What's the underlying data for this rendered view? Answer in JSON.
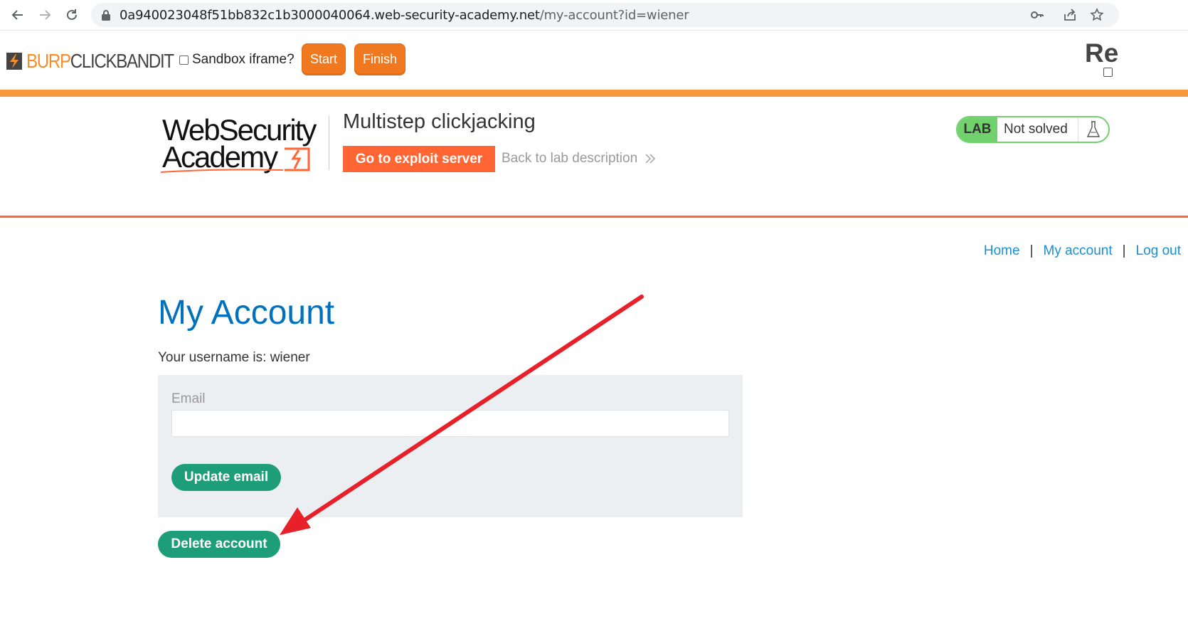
{
  "browser": {
    "url_host": "0a940023048f51bb832c1b3000040064.web-security-academy.net",
    "url_path": "/my-account?id=wiener"
  },
  "clickbandit": {
    "logo_burp": "BURP",
    "logo_clickbandit": "CLICKBANDIT",
    "sandbox_label": "Sandbox iframe?",
    "start_label": "Start",
    "finish_label": "Finish",
    "record_label_partial": "Re",
    "accent_color": "#f0791f"
  },
  "lab_header": {
    "logo_line1": "WebSecurity",
    "logo_line2": "Academy",
    "title": "Multistep clickjacking",
    "exploit_button": "Go to exploit server",
    "back_link": "Back to lab description",
    "status_tag": "LAB",
    "status_text": "Not solved",
    "status_color": "#70d16d"
  },
  "top_nav": {
    "home": "Home",
    "my_account": "My account",
    "log_out": "Log out",
    "separator": "|"
  },
  "account": {
    "title": "My Account",
    "username_text": "Your username is: wiener",
    "email_label": "Email",
    "email_value": "",
    "update_button": "Update email",
    "delete_button": "Delete account",
    "button_color": "#1d9e78"
  },
  "annotation": {
    "color": "#e8202a"
  }
}
